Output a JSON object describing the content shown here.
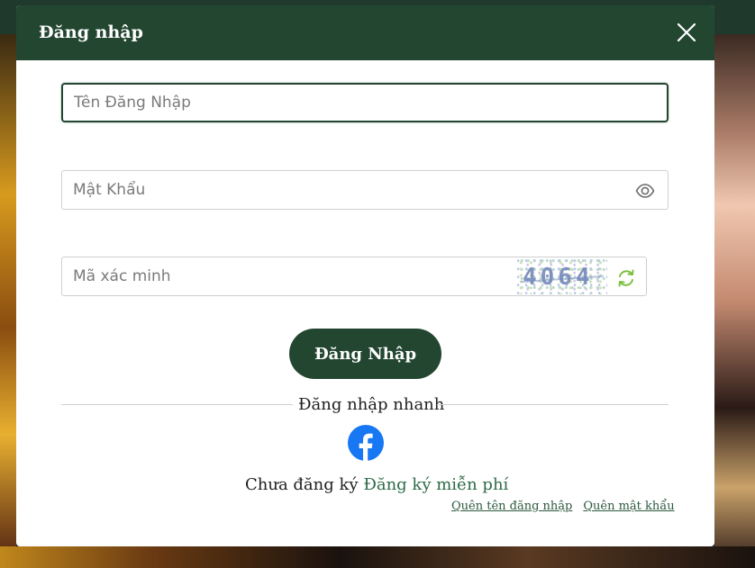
{
  "modal": {
    "title": "Đăng nhập"
  },
  "form": {
    "username_placeholder": "Tên Đăng Nhập",
    "password_placeholder": "Mật Khẩu",
    "captcha_placeholder": "Mã xác minh",
    "captcha_code": "4064",
    "submit_label": "Đăng Nhập"
  },
  "quick_login": {
    "label": "Đăng nhập nhanh"
  },
  "footer": {
    "no_account_text": "Chưa đăng ký",
    "signup_link": "Đăng ký miễn phí",
    "forgot_username": "Quên tên đăng nhập",
    "forgot_password": "Quên mật khẩu"
  },
  "icons": {
    "close": "close-icon",
    "eye": "eye-icon",
    "refresh": "refresh-icon",
    "facebook": "facebook-icon"
  },
  "colors": {
    "brand": "#234631",
    "link": "#2e6a48",
    "refresh": "#7cbf3f",
    "facebook": "#1877f2"
  }
}
